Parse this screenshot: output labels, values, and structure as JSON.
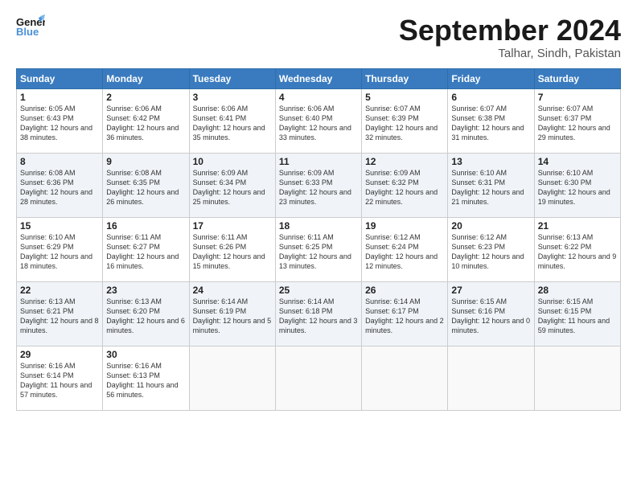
{
  "header": {
    "logo_line1": "General",
    "logo_line2": "Blue",
    "month_title": "September 2024",
    "location": "Talhar, Sindh, Pakistan"
  },
  "columns": [
    "Sunday",
    "Monday",
    "Tuesday",
    "Wednesday",
    "Thursday",
    "Friday",
    "Saturday"
  ],
  "weeks": [
    [
      {
        "day": "1",
        "sunrise": "6:05 AM",
        "sunset": "6:43 PM",
        "daylight": "12 hours and 38 minutes."
      },
      {
        "day": "2",
        "sunrise": "6:06 AM",
        "sunset": "6:42 PM",
        "daylight": "12 hours and 36 minutes."
      },
      {
        "day": "3",
        "sunrise": "6:06 AM",
        "sunset": "6:41 PM",
        "daylight": "12 hours and 35 minutes."
      },
      {
        "day": "4",
        "sunrise": "6:06 AM",
        "sunset": "6:40 PM",
        "daylight": "12 hours and 33 minutes."
      },
      {
        "day": "5",
        "sunrise": "6:07 AM",
        "sunset": "6:39 PM",
        "daylight": "12 hours and 32 minutes."
      },
      {
        "day": "6",
        "sunrise": "6:07 AM",
        "sunset": "6:38 PM",
        "daylight": "12 hours and 31 minutes."
      },
      {
        "day": "7",
        "sunrise": "6:07 AM",
        "sunset": "6:37 PM",
        "daylight": "12 hours and 29 minutes."
      }
    ],
    [
      {
        "day": "8",
        "sunrise": "6:08 AM",
        "sunset": "6:36 PM",
        "daylight": "12 hours and 28 minutes."
      },
      {
        "day": "9",
        "sunrise": "6:08 AM",
        "sunset": "6:35 PM",
        "daylight": "12 hours and 26 minutes."
      },
      {
        "day": "10",
        "sunrise": "6:09 AM",
        "sunset": "6:34 PM",
        "daylight": "12 hours and 25 minutes."
      },
      {
        "day": "11",
        "sunrise": "6:09 AM",
        "sunset": "6:33 PM",
        "daylight": "12 hours and 23 minutes."
      },
      {
        "day": "12",
        "sunrise": "6:09 AM",
        "sunset": "6:32 PM",
        "daylight": "12 hours and 22 minutes."
      },
      {
        "day": "13",
        "sunrise": "6:10 AM",
        "sunset": "6:31 PM",
        "daylight": "12 hours and 21 minutes."
      },
      {
        "day": "14",
        "sunrise": "6:10 AM",
        "sunset": "6:30 PM",
        "daylight": "12 hours and 19 minutes."
      }
    ],
    [
      {
        "day": "15",
        "sunrise": "6:10 AM",
        "sunset": "6:29 PM",
        "daylight": "12 hours and 18 minutes."
      },
      {
        "day": "16",
        "sunrise": "6:11 AM",
        "sunset": "6:27 PM",
        "daylight": "12 hours and 16 minutes."
      },
      {
        "day": "17",
        "sunrise": "6:11 AM",
        "sunset": "6:26 PM",
        "daylight": "12 hours and 15 minutes."
      },
      {
        "day": "18",
        "sunrise": "6:11 AM",
        "sunset": "6:25 PM",
        "daylight": "12 hours and 13 minutes."
      },
      {
        "day": "19",
        "sunrise": "6:12 AM",
        "sunset": "6:24 PM",
        "daylight": "12 hours and 12 minutes."
      },
      {
        "day": "20",
        "sunrise": "6:12 AM",
        "sunset": "6:23 PM",
        "daylight": "12 hours and 10 minutes."
      },
      {
        "day": "21",
        "sunrise": "6:13 AM",
        "sunset": "6:22 PM",
        "daylight": "12 hours and 9 minutes."
      }
    ],
    [
      {
        "day": "22",
        "sunrise": "6:13 AM",
        "sunset": "6:21 PM",
        "daylight": "12 hours and 8 minutes."
      },
      {
        "day": "23",
        "sunrise": "6:13 AM",
        "sunset": "6:20 PM",
        "daylight": "12 hours and 6 minutes."
      },
      {
        "day": "24",
        "sunrise": "6:14 AM",
        "sunset": "6:19 PM",
        "daylight": "12 hours and 5 minutes."
      },
      {
        "day": "25",
        "sunrise": "6:14 AM",
        "sunset": "6:18 PM",
        "daylight": "12 hours and 3 minutes."
      },
      {
        "day": "26",
        "sunrise": "6:14 AM",
        "sunset": "6:17 PM",
        "daylight": "12 hours and 2 minutes."
      },
      {
        "day": "27",
        "sunrise": "6:15 AM",
        "sunset": "6:16 PM",
        "daylight": "12 hours and 0 minutes."
      },
      {
        "day": "28",
        "sunrise": "6:15 AM",
        "sunset": "6:15 PM",
        "daylight": "11 hours and 59 minutes."
      }
    ],
    [
      {
        "day": "29",
        "sunrise": "6:16 AM",
        "sunset": "6:14 PM",
        "daylight": "11 hours and 57 minutes."
      },
      {
        "day": "30",
        "sunrise": "6:16 AM",
        "sunset": "6:13 PM",
        "daylight": "11 hours and 56 minutes."
      },
      null,
      null,
      null,
      null,
      null
    ]
  ]
}
